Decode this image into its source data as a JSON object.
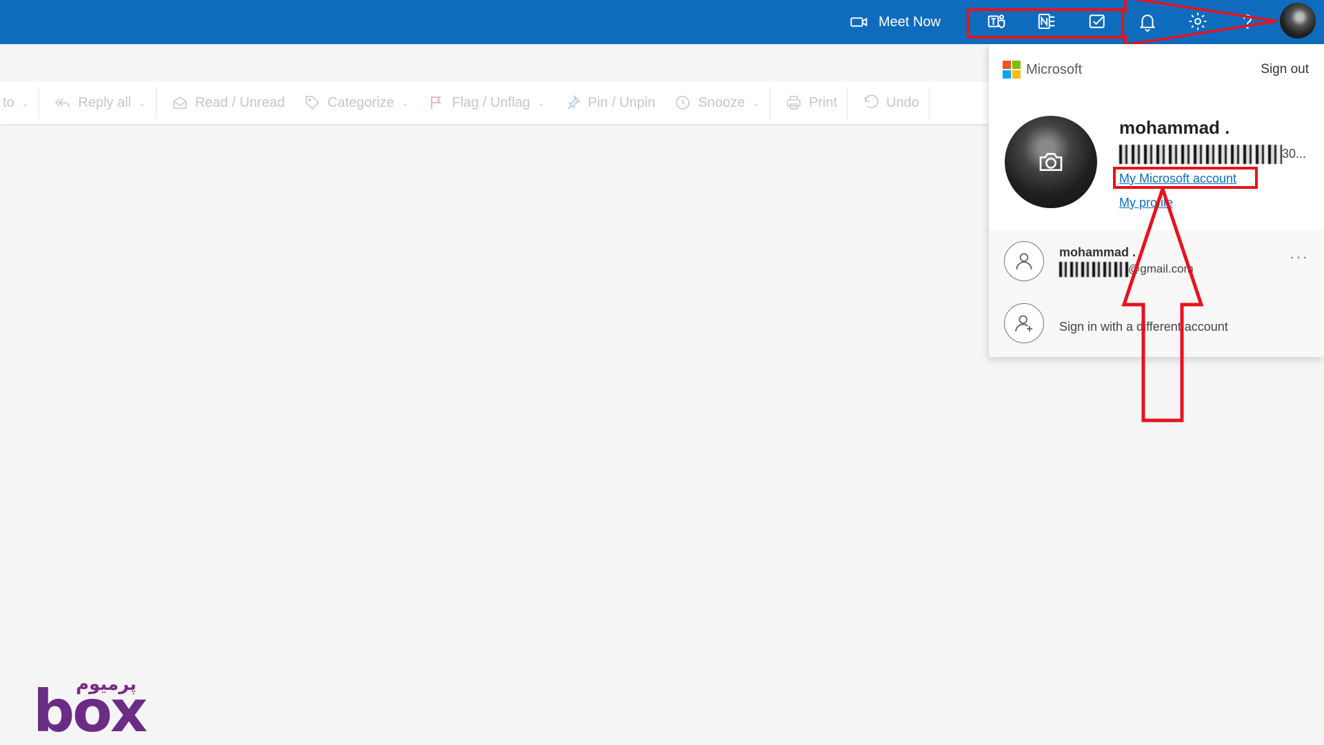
{
  "header": {
    "meet_now_label": "Meet Now",
    "icons": [
      "teams-icon",
      "onenote-icon",
      "todo-icon",
      "bell-icon",
      "gear-icon",
      "help-icon"
    ],
    "accent_color": "#0f6cbd"
  },
  "toolbar": {
    "items": [
      {
        "label": "to",
        "icon": "chevron-down-icon"
      },
      {
        "label": "Reply all",
        "icon": "reply-all-icon"
      },
      {
        "label": "Read / Unread",
        "icon": "envelope-icon"
      },
      {
        "label": "Categorize",
        "icon": "tag-icon"
      },
      {
        "label": "Flag / Unflag",
        "icon": "flag-icon"
      },
      {
        "label": "Pin / Unpin",
        "icon": "pin-icon"
      },
      {
        "label": "Snooze",
        "icon": "clock-icon"
      },
      {
        "label": "Print",
        "icon": "print-icon"
      },
      {
        "label": "Undo",
        "icon": "undo-icon"
      }
    ]
  },
  "account_panel": {
    "brand": "Microsoft",
    "sign_out": "Sign out",
    "name": "mohammad .",
    "email_suffix": "30...",
    "my_account_link": "My Microsoft account",
    "my_profile_link": "My profile",
    "other_account": {
      "name": "mohammad .",
      "email_suffix": "@gmail.com"
    },
    "more_label": "···",
    "sign_in_different": "Sign in with a different account"
  },
  "watermark": {
    "arabic": "پرمیوم",
    "latin": "box"
  },
  "annotation_color": "#e8121c"
}
